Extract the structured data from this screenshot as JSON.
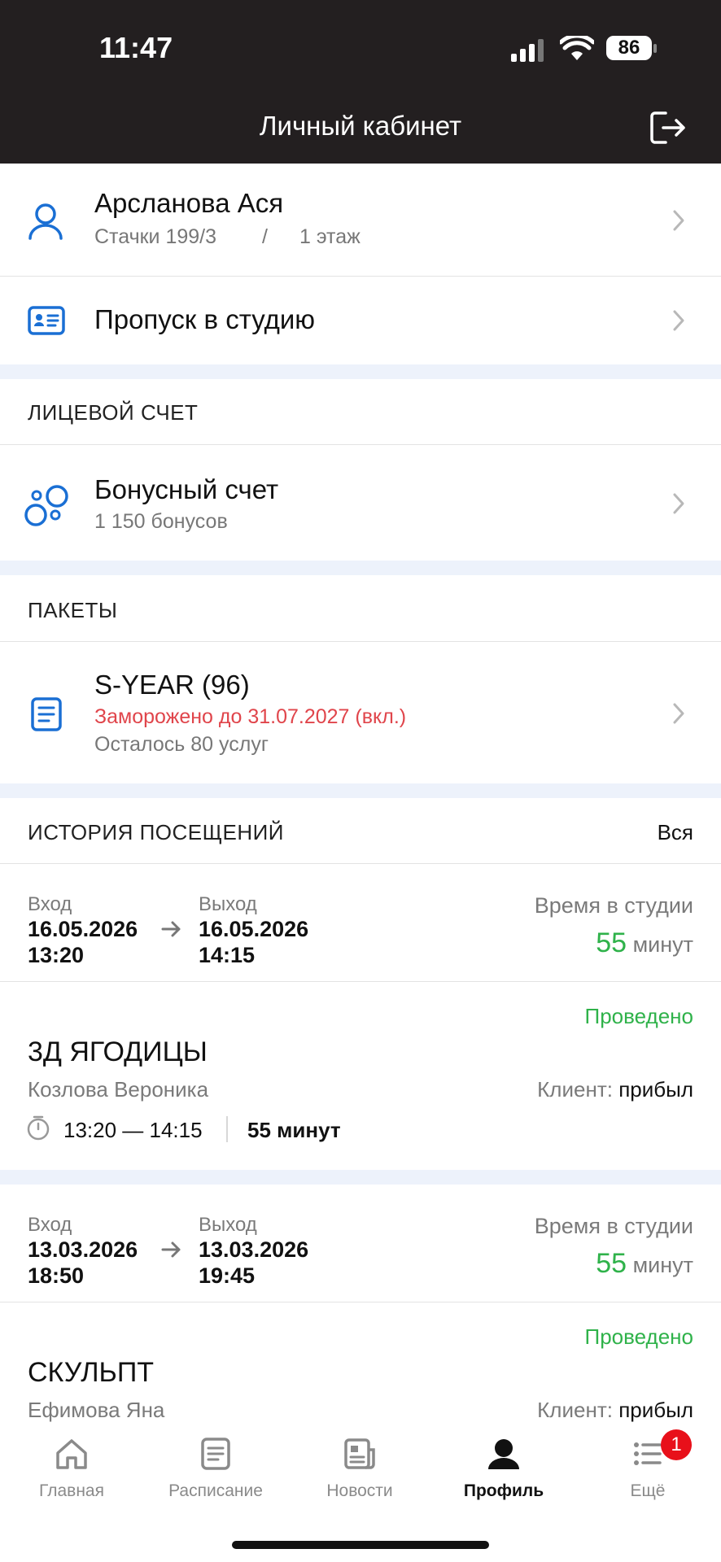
{
  "status": {
    "time": "11:47",
    "battery": "86"
  },
  "header": {
    "title": "Личный кабинет"
  },
  "profile": {
    "name": "Арсланова Ася",
    "address": "Стачки 199/3",
    "sep": "/",
    "floor": "1 этаж"
  },
  "pass": {
    "label": "Пропуск в студию"
  },
  "account": {
    "section": "ЛИЦЕВОЙ СЧЕТ",
    "bonus_title": "Бонусный счет",
    "bonus_value": "1 150 бонусов"
  },
  "packages": {
    "section": "ПАКЕТЫ",
    "name": "S-YEAR (96)",
    "frozen": "Заморожено до 31.07.2027 (вкл.)",
    "remaining": "Осталось 80 услуг"
  },
  "history": {
    "section": "ИСТОРИЯ ПОСЕЩЕНИЙ",
    "all": "Вся",
    "entries": [
      {
        "in_label": "Вход",
        "in_date": "16.05.2026",
        "in_time": "13:20",
        "out_label": "Выход",
        "out_date": "16.05.2026",
        "out_time": "14:15",
        "studio_label": "Время в студии",
        "studio_minutes": "55",
        "minutes_unit": "минут",
        "status": "Проведено",
        "class_name": "3Д ЯГОДИЦЫ",
        "trainer": "Козлова Вероника",
        "client_label": "Клиент:",
        "client_status": "прибыл",
        "time_range": "13:20 — 14:15",
        "duration": "55 минут"
      },
      {
        "in_label": "Вход",
        "in_date": "13.03.2026",
        "in_time": "18:50",
        "out_label": "Выход",
        "out_date": "13.03.2026",
        "out_time": "19:45",
        "studio_label": "Время в студии",
        "studio_minutes": "55",
        "minutes_unit": "минут",
        "status": "Проведено",
        "class_name": "СКУЛЬПТ",
        "trainer": "Ефимова Яна",
        "client_label": "Клиент:",
        "client_status": "прибыл"
      }
    ]
  },
  "tabs": [
    {
      "label": "Главная",
      "icon": "home-icon"
    },
    {
      "label": "Расписание",
      "icon": "schedule-icon"
    },
    {
      "label": "Новости",
      "icon": "news-icon"
    },
    {
      "label": "Профиль",
      "icon": "profile-icon"
    },
    {
      "label": "Ещё",
      "icon": "more-icon",
      "badge": "1"
    }
  ],
  "colors": {
    "accent": "#1a6fd4",
    "green": "#2fb24a",
    "red": "#e0454b",
    "band": "#edf2fb",
    "header": "#231f20"
  }
}
